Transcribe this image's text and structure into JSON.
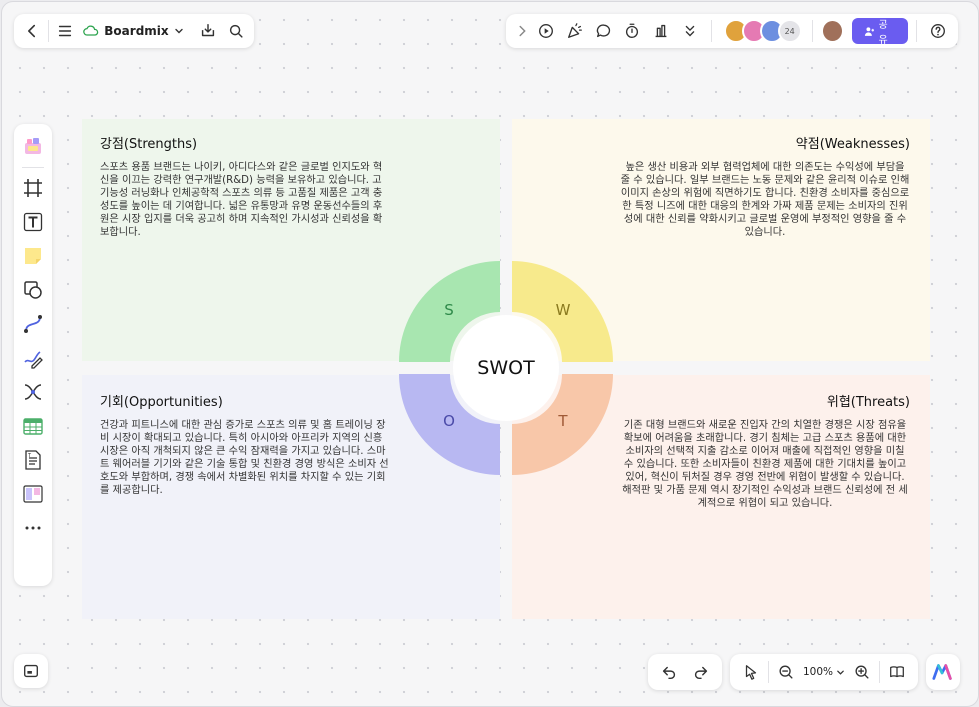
{
  "app": {
    "brand_name": "Boardmix",
    "share_label": "공유",
    "collaborator_count": "24",
    "zoom_level": "100%"
  },
  "swot": {
    "center_label": "SWOT",
    "strengths": {
      "letter": "S",
      "title": "강점(Strengths)",
      "body": "스포츠 용품 브랜드는 나이키, 아디다스와 같은 글로벌 인지도와 혁신을 이끄는 강력한 연구개발(R&D) 능력을 보유하고 있습니다. 고기능성 러닝화나 인체공학적 스포츠 의류 등 고품질 제품은 고객 충성도를 높이는 데 기여합니다. 넓은 유통망과 유명 운동선수들의 후원은 시장 입지를 더욱 공고히 하며 지속적인 가시성과 신뢰성을 확보합니다."
    },
    "weaknesses": {
      "letter": "W",
      "title": "약점(Weaknesses)",
      "body": "높은 생산 비용과 외부 협력업체에 대한 의존도는 수익성에 부담을 줄 수 있습니다. 일부 브랜드는 노동 문제와 같은 윤리적 이슈로 인해 이미지 손상의 위험에 직면하기도 합니다. 친환경 소비자를 중심으로 한 특정 니즈에 대한 대응의 한계와 가짜 제품 문제는 소비자의 진위성에 대한 신뢰를 약화시키고 글로벌 운영에 부정적인 영향을 줄 수 있습니다."
    },
    "opportunities": {
      "letter": "O",
      "title": "기회(Opportunities)",
      "body": "건강과 피트니스에 대한 관심 증가로 스포츠 의류 및 홈 트레이닝 장비 시장이 확대되고 있습니다. 특히 아시아와 아프리카 지역의 신흥 시장은 아직 개척되지 않은 큰 수익 잠재력을 가지고 있습니다. 스마트 웨어러블 기기와 같은 기술 통합 및 친환경 경영 방식은 소비자 선호도와 부합하며, 경쟁 속에서 차별화된 위치를 차지할 수 있는 기회를 제공합니다."
    },
    "threats": {
      "letter": "T",
      "title": "위협(Threats)",
      "body": "기존 대형 브랜드와 새로운 진입자 간의 치열한 경쟁은 시장 점유율 확보에 어려움을 초래합니다. 경기 침체는 고급 스포츠 용품에 대한 소비자의 선택적 지출 감소로 이어져 매출에 직접적인 영향을 미칠 수 있습니다. 또한 소비자들이 친환경 제품에 대한 기대치를 높이고 있어, 혁신이 뒤처질 경우 경영 전반에 위협이 발생할 수 있습니다. 해적판 및 가품 문제 역시 장기적인 수익성과 브랜드 신뢰성에 전 세계적으로 위협이 되고 있습니다."
    }
  },
  "colors": {
    "strengths_bg": "#eef6ec",
    "weaknesses_bg": "#fdf9ec",
    "opportunities_bg": "#f1f2f9",
    "threats_bg": "#fdf1ec",
    "s_arc": "#a8e6b0",
    "w_arc": "#f7ea8c",
    "o_arc": "#b8b8f2",
    "t_arc": "#f8c7a9",
    "accent": "#6a5cf0"
  },
  "icons": {
    "top_left": [
      "back-icon",
      "menu-icon",
      "cloud-icon",
      "chevron-down-icon",
      "download-icon",
      "search-icon"
    ],
    "top_right": [
      "expand-icon",
      "play-icon",
      "celebrate-icon",
      "comment-icon",
      "timer-icon",
      "vote-icon",
      "more-icon",
      "help-icon"
    ],
    "left_toolbar": [
      "template-icon",
      "frame-icon",
      "text-icon",
      "sticky-note-icon",
      "shape-icon",
      "connector-icon",
      "pen-icon",
      "mindmap-icon",
      "table-icon",
      "document-icon",
      "kanban-icon",
      "more-dots-icon"
    ],
    "bottom": [
      "minimap-icon",
      "undo-icon",
      "redo-icon",
      "cursor-icon",
      "zoom-out-icon",
      "zoom-in-icon",
      "book-icon",
      "ai-logo-icon"
    ]
  }
}
